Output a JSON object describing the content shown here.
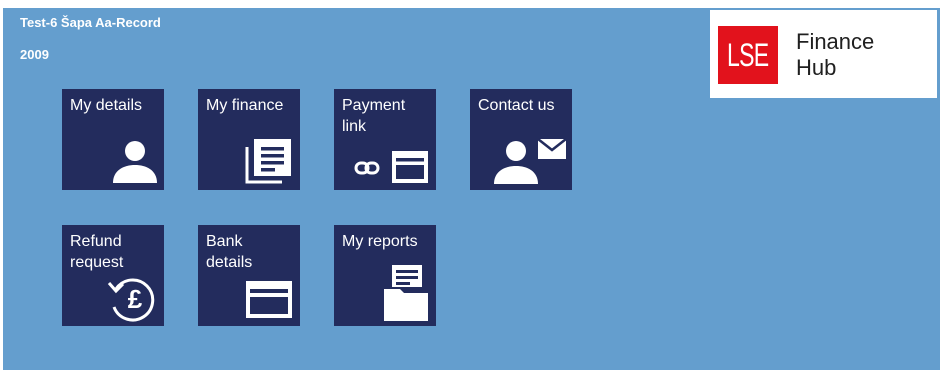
{
  "header": {
    "user_name": "Test-6 Šapa Aa-Record",
    "year": "2009"
  },
  "logo": {
    "mark": "LSE",
    "line1": "Finance",
    "line2": "Hub"
  },
  "colors": {
    "background": "#649ece",
    "tile": "#232c5d",
    "logo_red": "#e2121c"
  },
  "tiles": [
    {
      "line1": "My details",
      "line2": "",
      "icon": "person-icon"
    },
    {
      "line1": "My finance",
      "line2": "",
      "icon": "document-icon"
    },
    {
      "line1": "Payment",
      "line2": "link",
      "icon": "link-card-icon"
    },
    {
      "line1": "Contact us",
      "line2": "",
      "icon": "person-mail-icon"
    },
    {
      "line1": "Refund",
      "line2": "request",
      "icon": "pound-refund-icon"
    },
    {
      "line1": "Bank",
      "line2": "details",
      "icon": "card-icon"
    },
    {
      "line1": "My reports",
      "line2": "",
      "icon": "folder-report-icon"
    }
  ]
}
